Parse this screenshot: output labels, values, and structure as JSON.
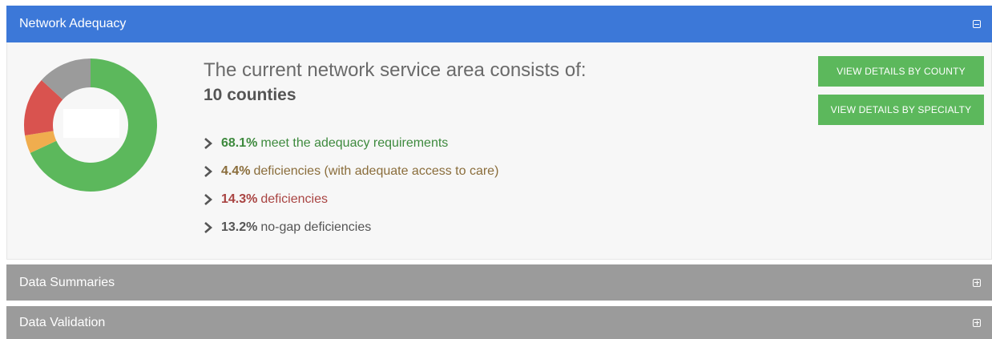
{
  "panels": {
    "network": {
      "title": "Network Adequacy",
      "expanded": true
    },
    "summaries": {
      "title": "Data Summaries",
      "expanded": false
    },
    "validation": {
      "title": "Data Validation",
      "expanded": false
    }
  },
  "summary": {
    "intro": "The current network service area consists of:",
    "count": "10 counties",
    "stats": [
      {
        "pct": "68.1%",
        "text": "meet the adequacy requirements",
        "color": "#3e8a3e"
      },
      {
        "pct": "4.4%",
        "text": "deficiencies (with adequate access to care)",
        "color": "#8a6d3b"
      },
      {
        "pct": "14.3%",
        "text": "deficiencies",
        "color": "#a94442"
      },
      {
        "pct": "13.2%",
        "text": "no-gap deficiencies",
        "color": "#555555"
      }
    ]
  },
  "buttons": {
    "by_county": "VIEW DETAILS BY COUNTY",
    "by_specialty": "VIEW DETAILS BY SPECIALTY"
  },
  "donut": {
    "segments": [
      {
        "label": "meet",
        "value": 68.1,
        "color": "#5cb85c"
      },
      {
        "label": "adequate-access",
        "value": 4.4,
        "color": "#f0ad4e"
      },
      {
        "label": "deficiencies",
        "value": 14.3,
        "color": "#d9534f"
      },
      {
        "label": "no-gap",
        "value": 13.2,
        "color": "#9b9b9b"
      }
    ]
  },
  "icons": {
    "collapse": "minus-square-icon",
    "expand": "plus-square-icon",
    "bullet": "chevron-right-icon"
  },
  "colors": {
    "header_active": "#3c78d8",
    "header_inactive": "#9b9b9b",
    "button": "#5cb85c"
  }
}
